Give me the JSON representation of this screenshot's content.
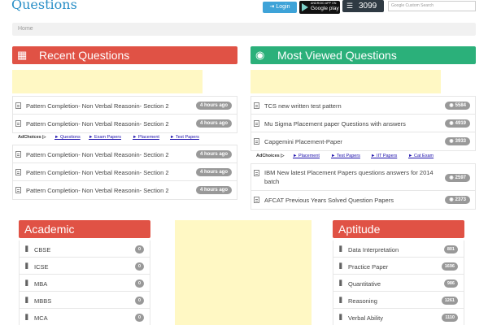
{
  "header": {
    "logo": "Questions",
    "login_label": "Login",
    "gplay_small": "ANDROID APP ON",
    "gplay_big": "Google play",
    "question_count": "3099",
    "search_placeholder": "Custom Search",
    "search_brand": "Google"
  },
  "breadcrumb": {
    "home": "Home"
  },
  "recent": {
    "title": "Recent Questions",
    "items_top": [
      {
        "text": "Pattern Completion- Non Verbal Reasonin- Section 2",
        "badge": "4 hours ago"
      },
      {
        "text": "Pattern Completion- Non Verbal Reasonin- Section 2",
        "badge": "4 hours ago"
      }
    ],
    "adlinks": {
      "label": "AdChoices ▷",
      "links": [
        "► Questions",
        "► Exam Papers",
        "► Placement",
        "► Test Papers"
      ]
    },
    "items_bottom": [
      {
        "text": "Pattern Completion- Non Verbal Reasonin- Section 2",
        "badge": "4 hours ago"
      },
      {
        "text": "Pattern Completion- Non Verbal Reasonin- Section 2",
        "badge": "4 hours ago"
      },
      {
        "text": "Pattern Completion- Non Verbal Reasonin- Section 2",
        "badge": "4 hours ago"
      }
    ]
  },
  "most_viewed": {
    "title": "Most Viewed Questions",
    "items_top": [
      {
        "text": "TCS new written test pattern",
        "badge": "5584"
      },
      {
        "text": "Mu Sigma Placement paper Questions with answers",
        "badge": "4919"
      },
      {
        "text": "Capgemini Placement-Paper",
        "badge": "3933"
      }
    ],
    "adlinks": {
      "label": "AdChoices ▷",
      "links": [
        "► Placement",
        "► Test Papers",
        "► IIT Papers",
        "► Cat Exam"
      ]
    },
    "items_bottom": [
      {
        "text": "IBM New latest Placement Papers questions answers for 2014 batch",
        "badge": "2597"
      },
      {
        "text": "AFCAT Previous Years Solved Question Papers",
        "badge": "2373"
      }
    ]
  },
  "academic": {
    "title": "Academic",
    "items": [
      {
        "text": "CBSE",
        "badge": "0"
      },
      {
        "text": "ICSE",
        "badge": "0"
      },
      {
        "text": "MBA",
        "badge": "0"
      },
      {
        "text": "MBBS",
        "badge": "0"
      },
      {
        "text": "MCA",
        "badge": "0"
      }
    ]
  },
  "aptitude": {
    "title": "Aptitude",
    "items": [
      {
        "text": "Data Interpretation",
        "badge": "801"
      },
      {
        "text": "Practice Paper",
        "badge": "1696"
      },
      {
        "text": "Quantitative",
        "badge": "986"
      },
      {
        "text": "Reasoning",
        "badge": "1261"
      },
      {
        "text": "Verbal Ability",
        "badge": "1110"
      }
    ]
  },
  "colors": {
    "red": "#e05245",
    "green": "#2bb07a",
    "ad_yellow": "#fff8c4",
    "badge": "#999999"
  }
}
